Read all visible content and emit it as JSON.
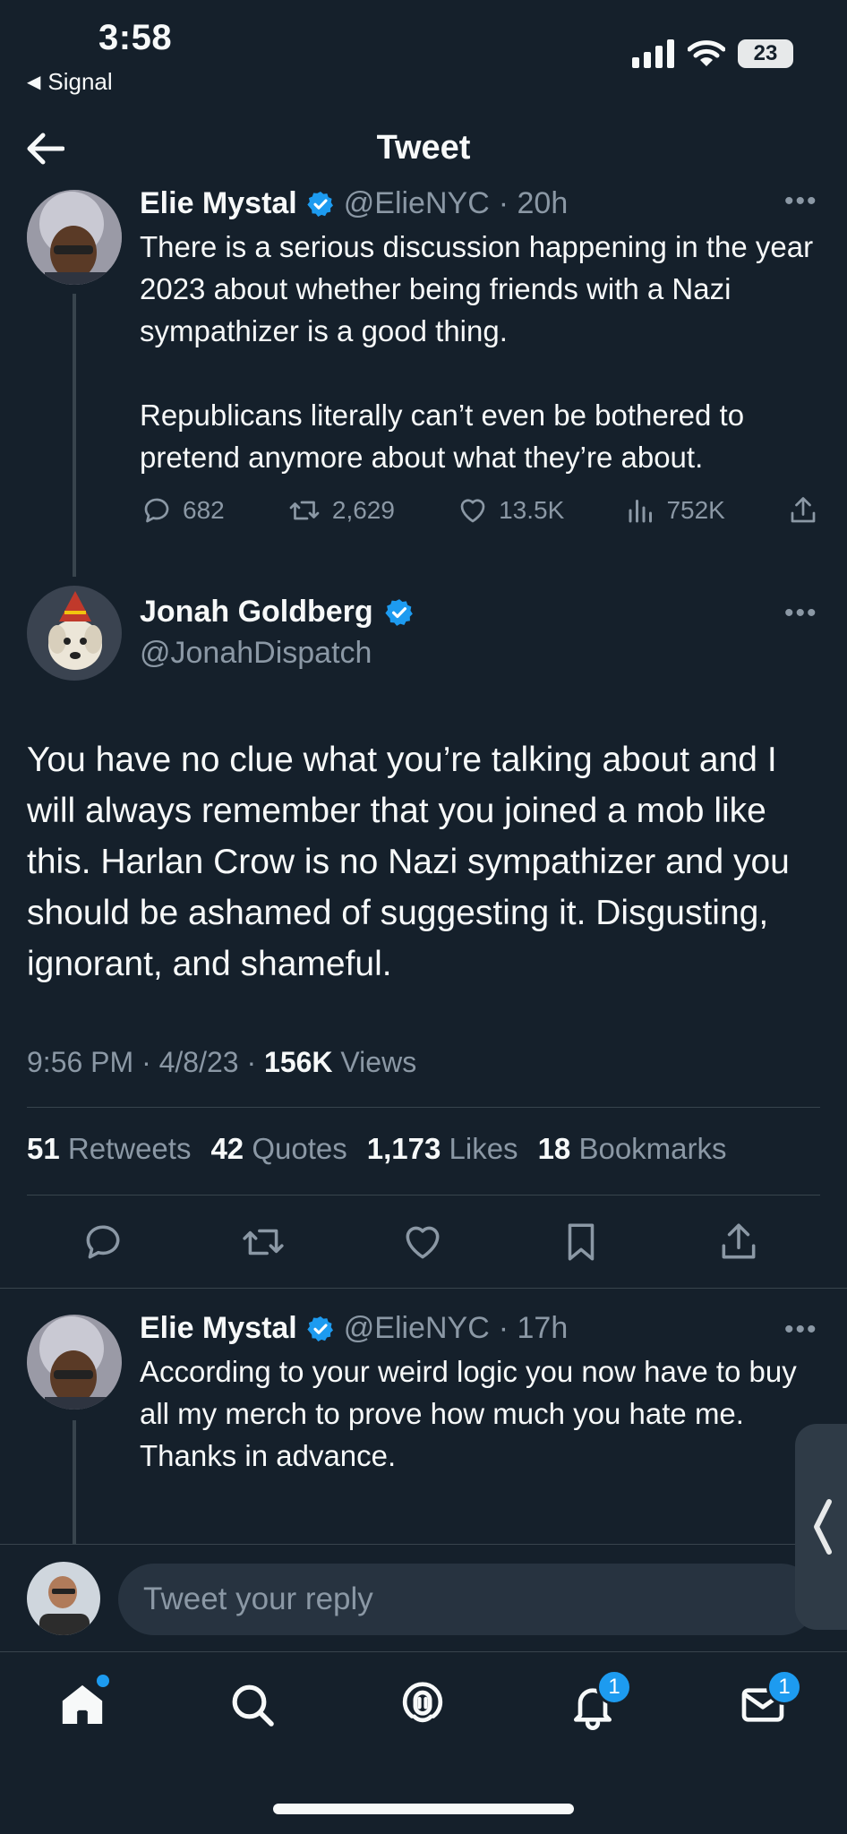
{
  "status_bar": {
    "time": "3:58",
    "back_app": "Signal",
    "battery": "23"
  },
  "header": {
    "title": "Tweet"
  },
  "parent_tweet": {
    "name": "Elie Mystal",
    "handle": "@ElieNYC",
    "age": "· 20h",
    "paragraph_1": "There is a serious discussion happening in the year 2023 about whether being friends with a Nazi sympathizer is a good thing.",
    "paragraph_2": "Republicans literally can’t even be bothered to pretend anymore about what they’re about.",
    "replies": "682",
    "retweets": "2,629",
    "likes": "13.5K",
    "views": "752K"
  },
  "main_tweet": {
    "name": "Jonah Goldberg",
    "handle": "@JonahDispatch",
    "text": "You have no clue what you’re talking about and I will always remember that you joined a mob like this. Harlan Crow is no Nazi sympathizer and you should be ashamed of suggesting it. Disgusting, ignorant, and shameful.",
    "time": "9:56 PM · 4/8/23 · ",
    "views_count": "156K",
    "views_label": " Views",
    "stats": {
      "retweets_count": "51",
      "retweets_label": "Retweets",
      "quotes_count": "42",
      "quotes_label": "Quotes",
      "likes_count": "1,173",
      "likes_label": "Likes",
      "bookmarks_count": "18",
      "bookmarks_label": "Bookmarks"
    }
  },
  "reply_tweet": {
    "name": "Elie Mystal",
    "handle": "@ElieNYC",
    "age": "· 17h",
    "line_1": "According to your weird logic you now have to buy all my merch to prove how much you hate me.",
    "line_2": "Thanks in advance."
  },
  "composer": {
    "placeholder": "Tweet your reply"
  },
  "tab_bar": {
    "notifications_badge": "1",
    "messages_badge": "1"
  },
  "colors": {
    "background": "#15202b",
    "accent": "#1d9bf0",
    "muted": "#8b98a5",
    "divider": "#38444d"
  },
  "icons": [
    "back-arrow-icon",
    "verified-icon",
    "more-icon",
    "reply-icon",
    "retweet-icon",
    "like-icon",
    "views-icon",
    "share-icon",
    "bookmark-icon",
    "home-icon",
    "search-icon",
    "spaces-icon",
    "notifications-icon",
    "messages-icon"
  ]
}
